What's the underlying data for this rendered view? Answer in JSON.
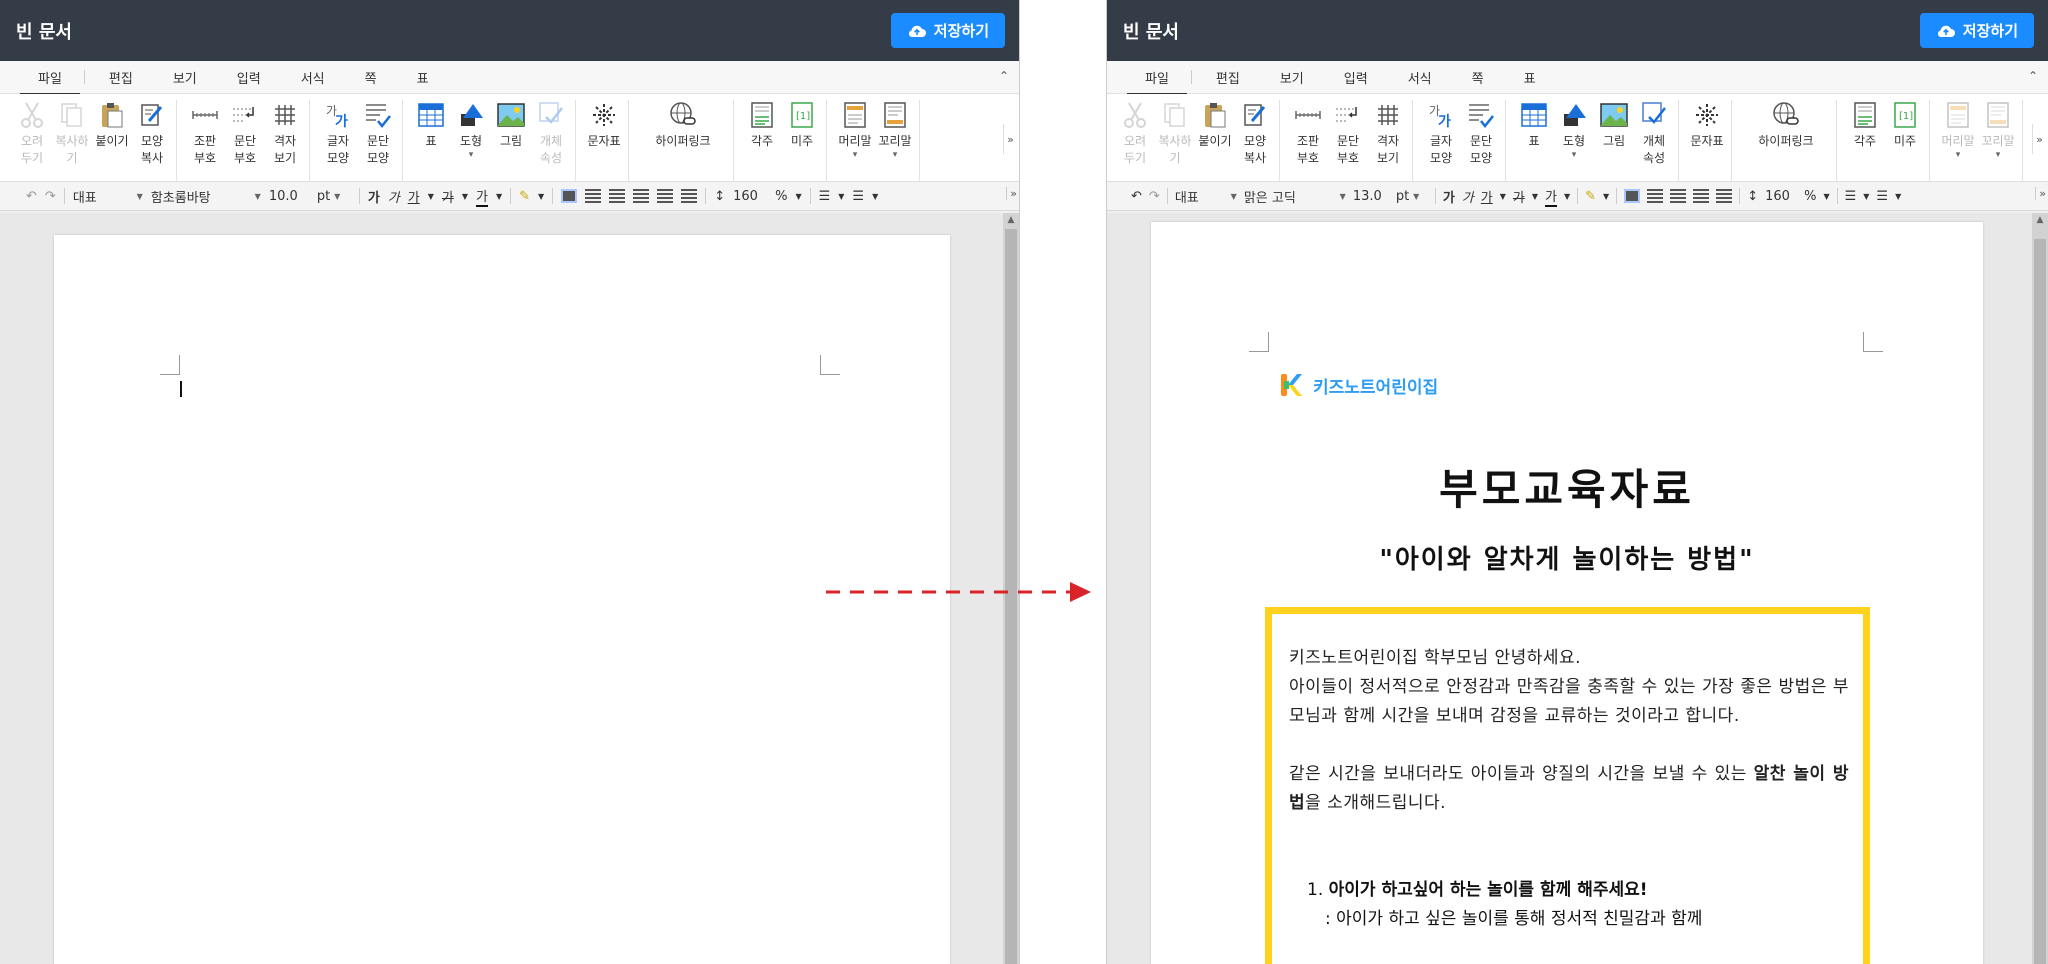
{
  "left": {
    "title": "빈 문서",
    "save_label": "저장하기"
  },
  "right": {
    "title": "빈 문서",
    "save_label": "저장하기"
  },
  "menu": [
    "파일",
    "편집",
    "보기",
    "입력",
    "서식",
    "쪽",
    "표"
  ],
  "ribbon_left": [
    {
      "label": "오려\n두기",
      "icon": "scissors-icon",
      "enabled": false
    },
    {
      "label": "복사하기",
      "icon": "copy-icon",
      "enabled": false
    },
    {
      "label": "붙이기",
      "icon": "paste-icon",
      "enabled": true
    },
    {
      "label": "모양\n복사",
      "icon": "format-painter-icon",
      "enabled": true
    },
    {
      "label": "조판\n부호",
      "icon": "typesetting-marks-icon",
      "enabled": true
    },
    {
      "label": "문단\n부호",
      "icon": "paragraph-marks-icon",
      "enabled": true
    },
    {
      "label": "격자\n보기",
      "icon": "grid-view-icon",
      "enabled": true
    },
    {
      "label": "글자\n모양",
      "icon": "char-shape-icon",
      "enabled": true
    },
    {
      "label": "문단\n모양",
      "icon": "para-shape-icon",
      "enabled": true
    },
    {
      "label": "표",
      "icon": "table-icon",
      "enabled": true
    },
    {
      "label": "도형",
      "icon": "shape-icon",
      "enabled": true
    },
    {
      "label": "그림",
      "icon": "picture-icon",
      "enabled": true
    },
    {
      "label": "개체\n속성",
      "icon": "object-props-icon",
      "enabled": false
    },
    {
      "label": "문자표",
      "icon": "symbol-icon",
      "enabled": true
    },
    {
      "label": "하이퍼링크",
      "icon": "hyperlink-icon",
      "enabled": true
    },
    {
      "label": "각주",
      "icon": "footnote-icon",
      "enabled": true
    },
    {
      "label": "미주",
      "icon": "endnote-icon",
      "enabled": true
    },
    {
      "label": "머리말",
      "icon": "header-icon",
      "enabled": true
    },
    {
      "label": "꼬리말",
      "icon": "footer-icon",
      "enabled": true
    }
  ],
  "ribbon_right": [
    {
      "label": "오려\n두기",
      "icon": "scissors-icon",
      "enabled": false
    },
    {
      "label": "복사하기",
      "icon": "copy-icon",
      "enabled": false
    },
    {
      "label": "붙이기",
      "icon": "paste-icon",
      "enabled": true
    },
    {
      "label": "모양\n복사",
      "icon": "format-painter-icon",
      "enabled": true
    },
    {
      "label": "조판\n부호",
      "icon": "typesetting-marks-icon",
      "enabled": true
    },
    {
      "label": "문단\n부호",
      "icon": "paragraph-marks-icon",
      "enabled": true
    },
    {
      "label": "격자\n보기",
      "icon": "grid-view-icon",
      "enabled": true
    },
    {
      "label": "글자\n모양",
      "icon": "char-shape-icon",
      "enabled": true
    },
    {
      "label": "문단\n모양",
      "icon": "para-shape-icon",
      "enabled": true
    },
    {
      "label": "표",
      "icon": "table-icon",
      "enabled": true
    },
    {
      "label": "도형",
      "icon": "shape-icon",
      "enabled": true
    },
    {
      "label": "그림",
      "icon": "picture-icon",
      "enabled": true
    },
    {
      "label": "개체\n속성",
      "icon": "object-props-icon",
      "enabled": true
    },
    {
      "label": "문자표",
      "icon": "symbol-icon",
      "enabled": true
    },
    {
      "label": "하이퍼링크",
      "icon": "hyperlink-icon",
      "enabled": true
    },
    {
      "label": "각주",
      "icon": "footnote-icon",
      "enabled": true
    },
    {
      "label": "미주",
      "icon": "endnote-icon",
      "enabled": true
    },
    {
      "label": "머리말",
      "icon": "header-icon",
      "enabled": false
    },
    {
      "label": "꼬리말",
      "icon": "footer-icon",
      "enabled": false
    }
  ],
  "format_left": {
    "style": "대표",
    "font": "함초롬바탕",
    "size": "10.0",
    "unit": "pt",
    "line_spacing": "160",
    "percent": "%"
  },
  "format_right": {
    "style": "대표",
    "font": "맑은 고딕",
    "size": "13.0",
    "unit": "pt",
    "line_spacing": "160",
    "percent": "%"
  },
  "doc": {
    "logo_text": "키즈노트어린이집",
    "title": "부모교육자료",
    "subtitle": "\"아이와 알차게 놀이하는 방법\"",
    "greeting": "키즈노트어린이집 학부모님 안녕하세요.",
    "para1": "아이들이 정서적으로 안정감과 만족감을 충족할 수 있는 가장 좋은 방법은 부모님과 함께 시간을 보내며 감정을 교류하는 것이라고 합니다.",
    "para2_a": "같은 시간을 보내더라도 아이들과 양질의 시간을 보낼 수 있는 ",
    "para2_b": "알찬 놀이 방법",
    "para2_c": "을 소개해드립니다.",
    "item1_num": "1.",
    "item1_title": "아이가 하고싶어 하는 놀이를 함께 해주세요!",
    "item1_sub": ": 아이가 하고 싶은 놀이를 통해 정서적 친밀감과 함께"
  },
  "colors": {
    "titlebar": "#343c47",
    "save": "#1a8cff",
    "box": "#ffd21e",
    "logo": "#2e9df4",
    "arrow": "#d9232a"
  }
}
